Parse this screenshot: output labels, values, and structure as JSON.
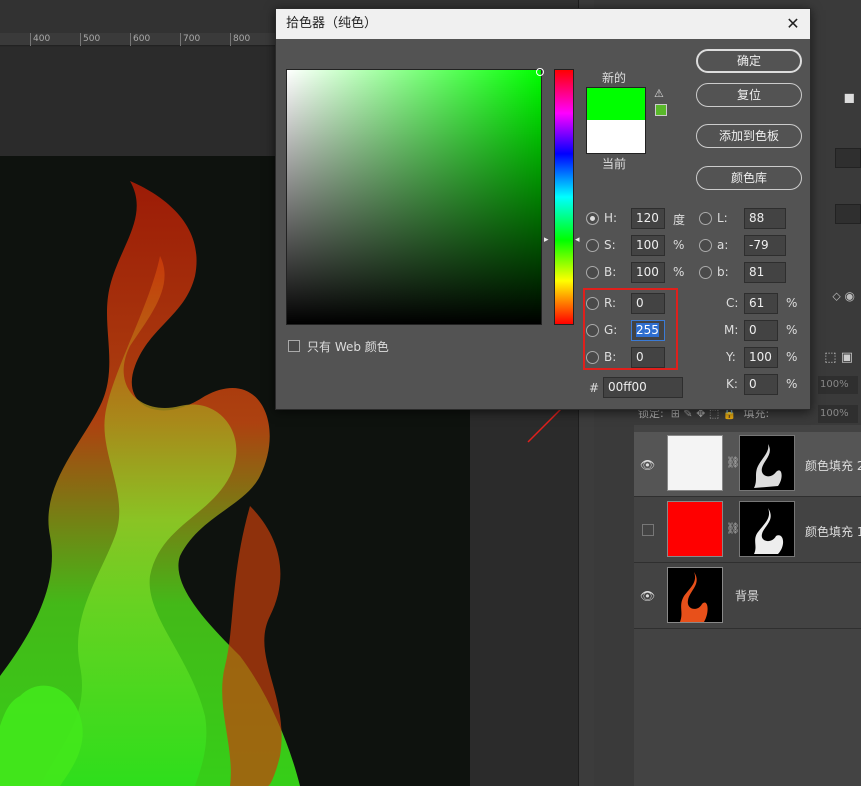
{
  "ruler": {
    "ticks": [
      "400",
      "500",
      "600",
      "700",
      "800"
    ]
  },
  "dialog": {
    "title": "拾色器（纯色）",
    "new_label": "新的",
    "current_label": "当前",
    "new_color": "#00ff00",
    "current_color": "#ffffff",
    "ok": "确定",
    "reset": "复位",
    "add_swatch": "添加到色板",
    "color_lib": "颜色库",
    "web_only": "只有 Web 颜色",
    "hsb": [
      {
        "k": "H:",
        "v": "120",
        "u": "度",
        "on": true
      },
      {
        "k": "S:",
        "v": "100",
        "u": "%",
        "on": false
      },
      {
        "k": "B:",
        "v": "100",
        "u": "%",
        "on": false
      }
    ],
    "lab": [
      {
        "k": "L:",
        "v": "88"
      },
      {
        "k": "a:",
        "v": "-79"
      },
      {
        "k": "b:",
        "v": "81"
      }
    ],
    "rgb": [
      {
        "k": "R:",
        "v": "0"
      },
      {
        "k": "G:",
        "v": "255"
      },
      {
        "k": "B:",
        "v": "0"
      }
    ],
    "cmyk": [
      {
        "k": "C:",
        "v": "61",
        "u": "%"
      },
      {
        "k": "M:",
        "v": "0",
        "u": "%"
      },
      {
        "k": "Y:",
        "v": "100",
        "u": "%"
      },
      {
        "k": "K:",
        "v": "0",
        "u": "%"
      }
    ],
    "hex_label": "#",
    "hex": "00ff00",
    "accent": "#e0201c"
  },
  "layers": {
    "lock_label": "锁定:",
    "fill_label": "填充:",
    "fill_value": "100%",
    "opacity_value": "100%",
    "items": [
      {
        "name": "颜色填充 2",
        "thumb": "#f4f4f4",
        "visible": true
      },
      {
        "name": "颜色填充 1",
        "thumb": "#ff0000",
        "visible": false
      },
      {
        "name": "背景",
        "thumb": "#000000",
        "visible": true
      }
    ]
  }
}
